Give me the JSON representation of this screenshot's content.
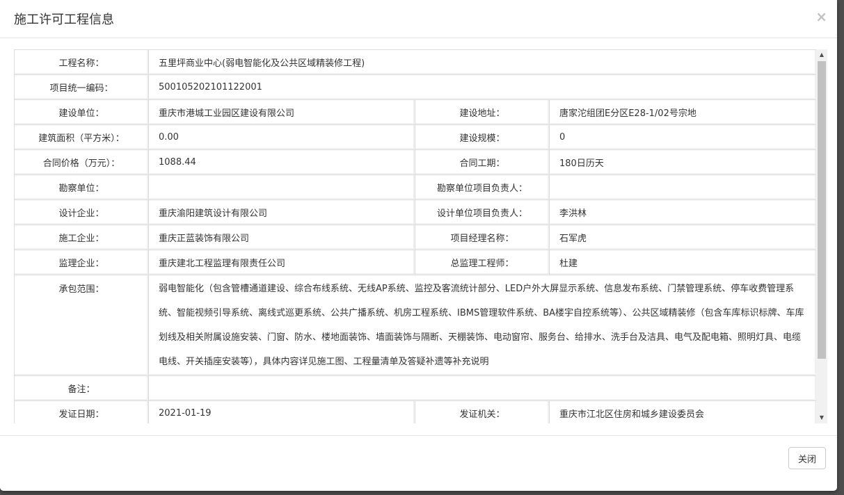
{
  "dialog": {
    "title": "施工许可工程信息",
    "close_icon": "×",
    "close_button": "关闭"
  },
  "rows": {
    "project_name": {
      "label": "工程名称：",
      "value": "五里坪商业中心(弱电智能化及公共区域精装修工程)"
    },
    "project_code": {
      "label": "项目统一编码：",
      "value": "500105202101122001"
    },
    "builder": {
      "label": "建设单位：",
      "value": "重庆市港城工业园区建设有限公司"
    },
    "build_address": {
      "label": "建设地址：",
      "value": "唐家沱组团E分区E28-1/02号宗地"
    },
    "area": {
      "label": "建筑面积（平方米）：",
      "value": "0.00"
    },
    "scale": {
      "label": "建设规模：",
      "value": "0"
    },
    "contract_price": {
      "label": "合同价格（万元）：",
      "value": "1088.44"
    },
    "contract_period": {
      "label": "合同工期：",
      "value": "180日历天"
    },
    "survey_unit": {
      "label": "勘察单位：",
      "value": ""
    },
    "survey_leader": {
      "label": "勘察单位项目负责人：",
      "value": ""
    },
    "design_company": {
      "label": "设计企业：",
      "value": "重庆渝阳建筑设计有限公司"
    },
    "design_leader": {
      "label": "设计单位项目负责人：",
      "value": "李洪林"
    },
    "construction_company": {
      "label": "施工企业：",
      "value": "重庆正蓝装饰有限公司"
    },
    "project_manager": {
      "label": "项目经理名称：",
      "value": "石军虎"
    },
    "supervision_company": {
      "label": "监理企业：",
      "value": "重庆建北工程监理有限责任公司"
    },
    "chief_supervisor": {
      "label": "总监理工程师：",
      "value": "杜建"
    },
    "scope": {
      "label": "承包范围：",
      "value": "弱电智能化（包含管槽通道建设、综合布线系统、无线AP系统、监控及客流统计部分、LED户外大屏显示系统、信息发布系统、门禁管理系统、停车收费管理系统、智能视频引导系统、离线式巡更系统、公共广播系统、机房工程系统、IBMS管理软件系统、BA楼宇自控系统等）、公共区域精装修（包含车库标识标牌、车库划线及相关附属设施安装、门窗、防水、楼地面装饰、墙面装饰与隔断、天棚装饰、电动窗帘、服务台、给排水、洗手台及洁具、电气及配电箱、照明灯具、电缆电线、开关插座安装等），具体内容详见施工图、工程量清单及答疑补遗等补充说明"
    },
    "remark": {
      "label": "备注：",
      "value": ""
    },
    "issue_date": {
      "label": "发证日期：",
      "value": "2021-01-19"
    },
    "issue_authority": {
      "label": "发证机关：",
      "value": "重庆市江北区住房和城乡建设委员会"
    }
  }
}
